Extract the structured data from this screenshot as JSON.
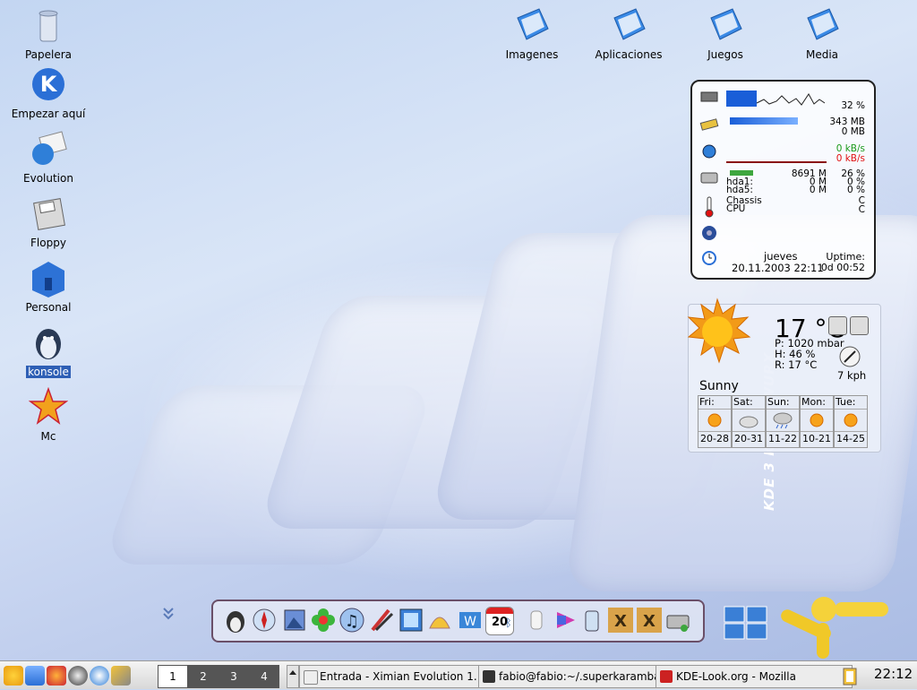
{
  "desktop_icons_left": [
    {
      "label": "Papelera",
      "icon": "trash-icon"
    },
    {
      "label": "Empezar aquí",
      "icon": "kde-start-icon"
    },
    {
      "label": "Evolution",
      "icon": "evolution-icon"
    },
    {
      "label": "Floppy",
      "icon": "floppy-icon"
    },
    {
      "label": "Personal",
      "icon": "home-icon"
    },
    {
      "label": "konsole",
      "icon": "penguin-icon"
    },
    {
      "label": "Mc",
      "icon": "mc-icon"
    }
  ],
  "desktop_icons_top": [
    {
      "label": "Imagenes",
      "icon": "folder-icon"
    },
    {
      "label": "Aplicaciones",
      "icon": "folder-icon"
    },
    {
      "label": "Juegos",
      "icon": "folder-icon"
    },
    {
      "label": "Media",
      "icon": "folder-icon"
    }
  ],
  "sysmon": {
    "cpu_percent": "32 %",
    "mem_used": "343 MB",
    "swap_used": "0 MB",
    "net_in": "0 kB/s",
    "net_out": "0 kB/s",
    "disk_total": "8691 M",
    "disk_total_pct": "26 %",
    "hda1_label": "hda1:",
    "hda1_size": "0 M",
    "hda1_pct": "0 %",
    "hda5_label": "hda5:",
    "hda5_size": "0 M",
    "hda5_pct": "0 %",
    "chassis_label": "Chassis",
    "chassis_unit": "C",
    "cpu_label": "CPU",
    "cpu_unit": "C",
    "day": "jueves",
    "datetime": "20.11.2003 22:11",
    "uptime_label": "Uptime:",
    "uptime": "0d 00:52",
    "colors": {
      "in": "#1a9a1a",
      "out": "#e01010",
      "bar": "#1a5ed8"
    }
  },
  "weather": {
    "temp": "17 °C",
    "pressure": "P: 1020 mbar",
    "humidity": "H: 46 %",
    "real": "R: 17 °C",
    "wind": "7 kph",
    "condition": "Sunny",
    "forecast": [
      {
        "day": "Fri:",
        "range": "20-28",
        "icon": "sun-icon"
      },
      {
        "day": "Sat:",
        "range": "20-31",
        "icon": "cloud-icon"
      },
      {
        "day": "Sun:",
        "range": "11-22",
        "icon": "rain-icon"
      },
      {
        "day": "Mon:",
        "range": "10-21",
        "icon": "sun-icon"
      },
      {
        "day": "Tue:",
        "range": "14-25",
        "icon": "sun-icon"
      }
    ]
  },
  "wallpaper_text": "KDE 3 KRAFTWURX",
  "taskbar": {
    "desktops": [
      "1",
      "2",
      "3",
      "4"
    ],
    "active_desktop": "1",
    "tasks": [
      {
        "label": "Entrada - Ximian Evolution 1.",
        "icon": "evolution-icon"
      },
      {
        "label": "fabio@fabio:~/.superkaramba",
        "icon": "terminal-icon"
      },
      {
        "label": "KDE-Look.org - Mozilla",
        "icon": "mozilla-icon"
      }
    ],
    "clock": "22:12",
    "calendar_date": "20"
  }
}
